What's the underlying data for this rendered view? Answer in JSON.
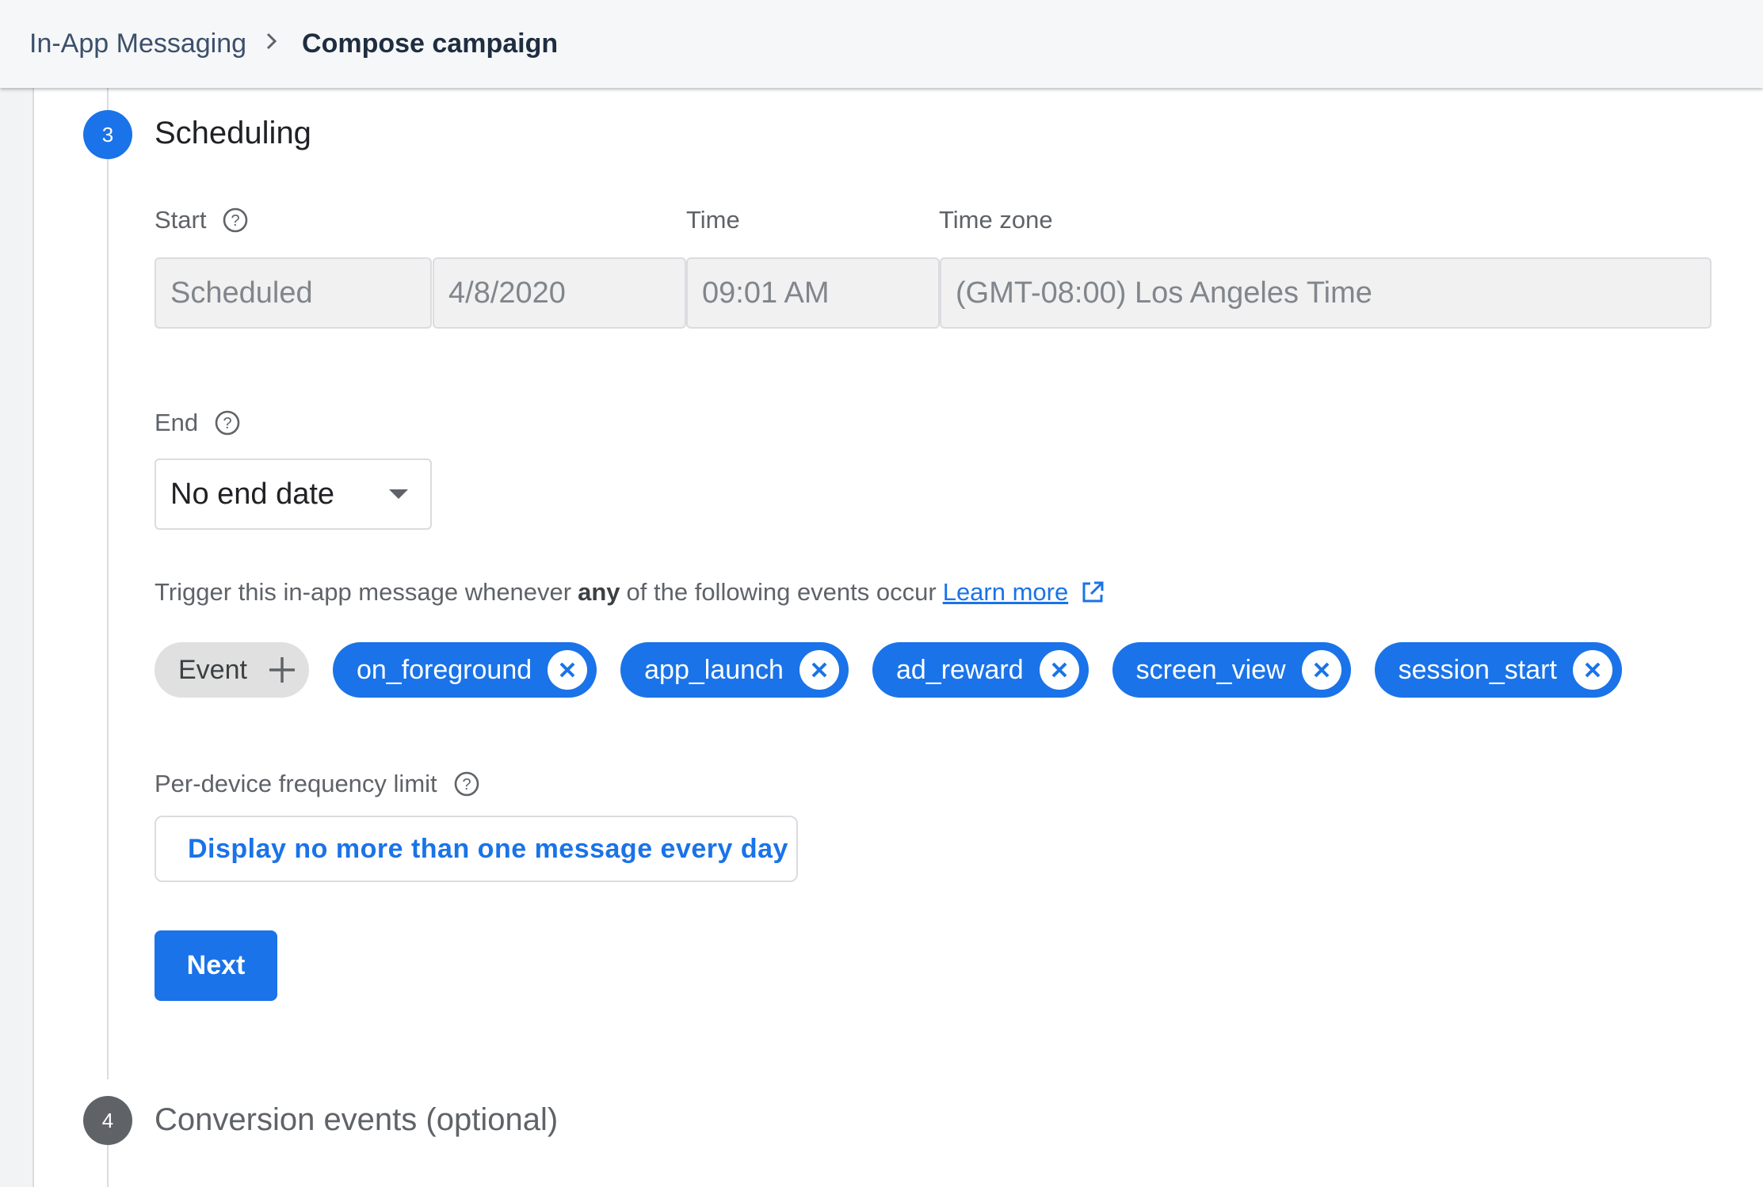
{
  "breadcrumb": {
    "parent": "In-App Messaging",
    "separator": ">",
    "current": "Compose campaign"
  },
  "steps": {
    "current": {
      "number": "3",
      "title": "Scheduling"
    },
    "next": {
      "number": "4",
      "title": "Conversion events (optional)"
    }
  },
  "start": {
    "label": "Start",
    "time_label": "Time",
    "timezone_label": "Time zone",
    "mode": "Scheduled",
    "date": "4/8/2020",
    "time": "09:01 AM",
    "timezone": "(GMT-08:00) Los Angeles Time"
  },
  "end": {
    "label": "End",
    "selected": "No end date"
  },
  "trigger": {
    "text_before": "Trigger this in-app message whenever",
    "bold": "any",
    "text_after": "of the following events occur",
    "learn_more": "Learn more",
    "add_chip_label": "Event",
    "events": [
      "on_foreground",
      "app_launch",
      "ad_reward",
      "screen_view",
      "session_start"
    ]
  },
  "frequency": {
    "label": "Per-device frequency limit",
    "button": "Display no more than one message every day"
  },
  "next_button": "Next",
  "colors": {
    "accent": "#1a73e8",
    "inactive_step": "#5f6368"
  }
}
